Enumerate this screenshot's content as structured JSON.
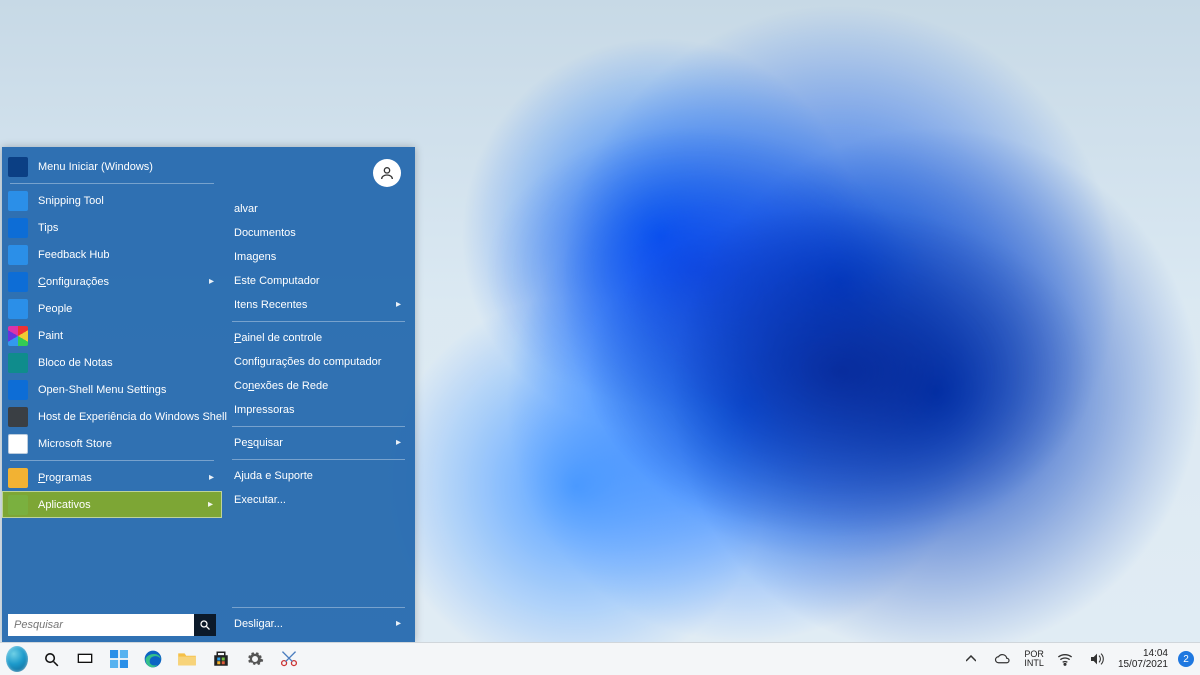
{
  "start_menu": {
    "left": [
      {
        "label": "Menu Iniciar (Windows)",
        "icon": "start-tile-icon",
        "color": "c-dblue"
      },
      {
        "label": "Snipping Tool",
        "icon": "scissors-icon",
        "color": "c-lblue"
      },
      {
        "label": "Tips",
        "icon": "lightbulb-icon",
        "color": "c-blue"
      },
      {
        "label": "Feedback Hub",
        "icon": "person-icon",
        "color": "c-lblue"
      },
      {
        "label": "Configurações",
        "icon": "gear-icon",
        "color": "c-blue",
        "arrow": true,
        "underline": true
      },
      {
        "label": "People",
        "icon": "people-icon",
        "color": "c-lblue"
      },
      {
        "label": "Paint",
        "icon": "palette-icon",
        "color": "c-palette"
      },
      {
        "label": "Bloco de Notas",
        "icon": "notepad-icon",
        "color": "c-teal"
      },
      {
        "label": "Open-Shell Menu Settings",
        "icon": "shell-icon",
        "color": "c-blue"
      },
      {
        "label": "Host de Experiência do Windows Shell",
        "icon": "shell-host-icon",
        "color": "c-grey"
      },
      {
        "label": "Microsoft Store",
        "icon": "store-icon",
        "color": "c-white"
      },
      {
        "label": "Programas",
        "icon": "folder-icon",
        "color": "c-yellow",
        "arrow": true,
        "underline": true
      },
      {
        "label": "Aplicativos",
        "icon": "apps-folder-icon",
        "color": "c-green",
        "arrow": true,
        "selected": true
      }
    ],
    "search_placeholder": "Pesquisar",
    "right": {
      "user_name": "alvar",
      "groups": [
        [
          "Documentos",
          "Imagens",
          "Este Computador",
          {
            "label": "Itens Recentes",
            "arrow": true
          }
        ],
        [
          {
            "label": "Painel de controle",
            "underline": true
          },
          "Configurações do computador",
          {
            "label": "Conexões de Rede",
            "underline_idx": 2
          },
          "Impressoras"
        ],
        [
          {
            "label": "Pesquisar",
            "arrow": true,
            "underline_idx": 2
          }
        ],
        [
          "Ajuda e Suporte",
          "Executar..."
        ]
      ],
      "power_label": "Desligar..."
    }
  },
  "taskbar": {
    "icons": [
      "start-button",
      "search",
      "task-view",
      "widgets",
      "edge",
      "file-explorer",
      "store",
      "settings",
      "snip"
    ],
    "tray": {
      "chevron": "^",
      "weather": "cloud",
      "lang_top": "POR",
      "lang_bottom": "INTL",
      "wifi": true,
      "volume": true,
      "time": "14:04",
      "date": "15/07/2021",
      "notif_count": "2"
    }
  }
}
